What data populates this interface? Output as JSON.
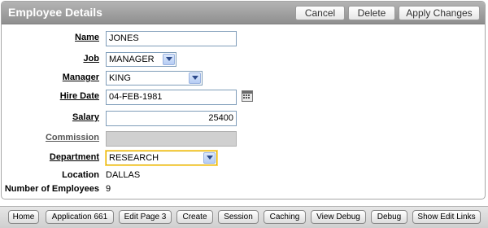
{
  "region": {
    "title": "Employee Details",
    "buttons": {
      "cancel": "Cancel",
      "delete": "Delete",
      "apply": "Apply Changes"
    }
  },
  "form": {
    "name": {
      "label": "Name",
      "value": "JONES"
    },
    "job": {
      "label": "Job",
      "value": "MANAGER"
    },
    "manager": {
      "label": "Manager",
      "value": "KING"
    },
    "hire_date": {
      "label": "Hire Date",
      "value": "04-FEB-1981"
    },
    "salary": {
      "label": "Salary",
      "value": "25400"
    },
    "commission": {
      "label": "Commission",
      "value": ""
    },
    "department": {
      "label": "Department",
      "value": "RESEARCH"
    },
    "location": {
      "label": "Location",
      "value": "DALLAS"
    },
    "num_employees": {
      "label": "Number of Employees",
      "value": "9"
    }
  },
  "developer_toolbar": {
    "buttons": [
      "Home",
      "Application 661",
      "Edit Page 3",
      "Create",
      "Session",
      "Caching",
      "View Debug",
      "Debug",
      "Show Edit Links"
    ]
  },
  "colors": {
    "header": "#a0a0a0",
    "focus_border": "#e0b000",
    "field_border": "#7f9db9"
  }
}
